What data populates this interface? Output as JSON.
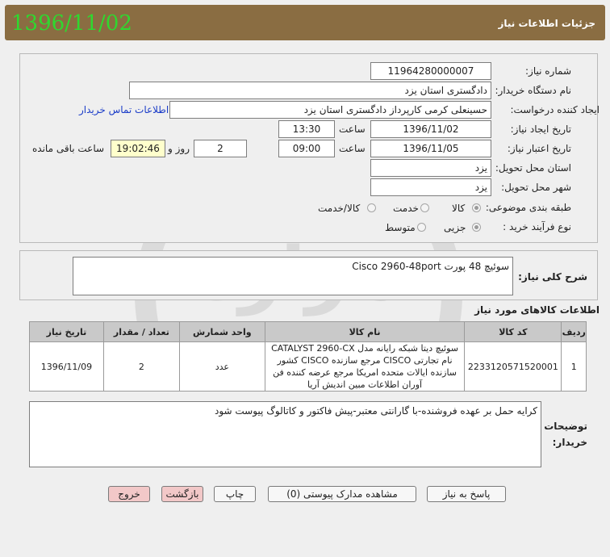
{
  "header": {
    "title": "جزئیات اطلاعات نیاز",
    "date": "1396/11/02"
  },
  "form": {
    "need_number_label": "شماره نیاز:",
    "need_number": "11964280000007",
    "buyer_org_label": "نام دستگاه خریدار:",
    "buyer_org": "دادگستری استان یزد",
    "creator_label": "ایجاد کننده درخواست:",
    "creator": "حسینعلی کرمی کارپرداز  دادگستری استان یزد",
    "contact_link": "اطلاعات تماس خریدار",
    "created_date_label": "تاریخ ایجاد نیاز:",
    "created_date": "1396/11/02",
    "time_label": "ساعت",
    "created_time": "13:30",
    "validity_label": "تاریخ اعتبار نیاز:",
    "validity_date": "1396/11/05",
    "validity_time": "09:00",
    "days": "2",
    "days_label": "روز و",
    "remaining": "19:02:46",
    "remaining_label": "ساعت باقی مانده",
    "province_label": "استان محل تحویل:",
    "province": "یزد",
    "city_label": "شهر محل تحویل:",
    "city": "یزد",
    "category_label": "طبقه بندی موضوعی:",
    "category_options": [
      "کالا",
      "خدمت",
      "کالا/خدمت"
    ],
    "process_label": "نوع فرآیند خرید :",
    "process_options": [
      "جزیی",
      "متوسط"
    ]
  },
  "summary": {
    "label": "شرح کلی نیاز:",
    "text": "سوئیچ 48 پورت    Cisco 2960-48port"
  },
  "items": {
    "title": "اطلاعات کالاهای مورد نیاز",
    "headers": [
      "ردیف",
      "کد کالا",
      "نام کالا",
      "واحد شمارش",
      "تعداد / مقدار",
      "تاریخ نیاز"
    ],
    "rows": [
      {
        "row": "1",
        "code": "2233120571520001",
        "name": "سوئیچ دیتا شبکه رایانه مدل CATALYST 2960-CX نام تجارتی CISCO مرجع سازنده CISCO کشور سازنده ایالات متحده امریکا مرجع عرضه کننده فن آوران اطلاعات مبین اندیش آریا",
        "unit": "عدد",
        "qty": "2",
        "date": "1396/11/09"
      }
    ]
  },
  "notes": {
    "label1": "توضیحات",
    "label2": "خریدار:",
    "text": "کرایه حمل بر عهده فروشنده-با گارانتی معتبر-پیش فاکتور و کاتالوگ پیوست شود"
  },
  "buttons": {
    "reply": "پاسخ به نیاز",
    "attachments": "مشاهده مدارک پیوستی (0)",
    "print": "چاپ",
    "back": "بازگشت",
    "exit": "خروج"
  },
  "watermark": {
    "text1": "هزاره",
    "text2": "ارتباط گستران"
  }
}
